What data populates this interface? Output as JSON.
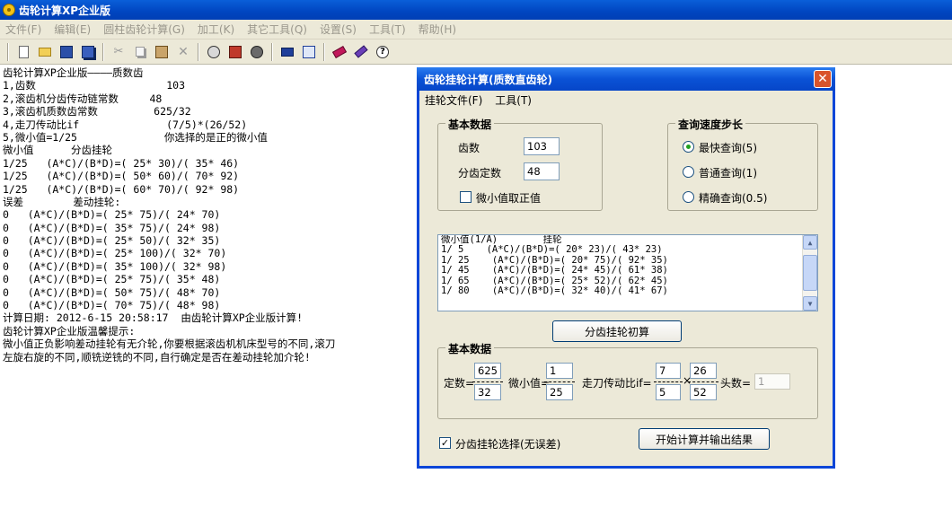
{
  "window": {
    "title": "齿轮计算XP企业版"
  },
  "menu": [
    "文件(F)",
    "编辑(E)",
    "圆柱齿轮计算(G)",
    "加工(K)",
    "其它工具(Q)",
    "设置(S)",
    "工具(T)",
    "帮助(H)"
  ],
  "toolbar_icons": [
    "new-icon",
    "open-icon",
    "save-icon",
    "save-all-icon",
    "cut-icon",
    "copy-icon",
    "paste-icon",
    "delete-icon",
    "print-preview-icon",
    "print-icon",
    "gear-settings-icon",
    "calculator-icon",
    "export-icon",
    "book-icon",
    "edit-icon",
    "help-icon"
  ],
  "log_lines": [
    "齿轮计算XP企业版————质数齿",
    "1,齿数                     103",
    "2,滚齿机分齿传动链常数     48",
    "3,滚齿机质数齿常数         625/32",
    "4,走刀传动比if              (7/5)*(26/52)",
    "5,微小值=1/25              你选择的是正的微小值",
    "微小值      分齿挂轮",
    "1/25   (A*C)/(B*D)=( 25* 30)/( 35* 46)",
    "1/25   (A*C)/(B*D)=( 50* 60)/( 70* 92)",
    "1/25   (A*C)/(B*D)=( 60* 70)/( 92* 98)",
    "误差        差动挂轮:",
    "0   (A*C)/(B*D)=( 25* 75)/( 24* 70)",
    "0   (A*C)/(B*D)=( 35* 75)/( 24* 98)",
    "0   (A*C)/(B*D)=( 25* 50)/( 32* 35)",
    "0   (A*C)/(B*D)=( 25* 100)/( 32* 70)",
    "0   (A*C)/(B*D)=( 35* 100)/( 32* 98)",
    "0   (A*C)/(B*D)=( 25* 75)/( 35* 48)",
    "0   (A*C)/(B*D)=( 50* 75)/( 48* 70)",
    "0   (A*C)/(B*D)=( 70* 75)/( 48* 98)",
    "计算日期: 2012-6-15 20:58:17  由齿轮计算XP企业版计算!",
    "齿轮计算XP企业版温馨提示:",
    "微小值正负影响差动挂轮有无介轮,你要根据滚齿机机床型号的不同,滚刀",
    "左旋右旋的不同,顺铣逆铣的不同,自行确定是否在差动挂轮加介轮!"
  ],
  "dialog": {
    "title": "齿轮挂轮计算(质数直齿轮)",
    "menu": [
      "挂轮文件(F)",
      "工具(T)"
    ],
    "basic": {
      "title": "基本数据",
      "teeth_label": "齿数",
      "teeth_value": "103",
      "index_label": "分齿定数",
      "index_value": "48",
      "positive_label": "微小值取正值",
      "positive_checked": false
    },
    "speed": {
      "title": "查询速度步长",
      "options": [
        "最快查询(5)",
        "普通查询(1)",
        "精确查询(0.5)"
      ],
      "selected": 0
    },
    "results": [
      "微小值(1/A)        挂轮",
      "1/ 5    (A*C)/(B*D)=( 20* 23)/( 43* 23)",
      "1/ 25    (A*C)/(B*D)=( 20* 75)/( 92* 35)",
      "1/ 45    (A*C)/(B*D)=( 24* 45)/( 61* 38)",
      "1/ 65    (A*C)/(B*D)=( 25* 52)/( 62* 45)",
      "1/ 80    (A*C)/(B*D)=( 32* 40)/( 41* 67)"
    ],
    "calc_index_button": "分齿挂轮初算",
    "basic2": {
      "title": "基本数据",
      "constant_label": "定数=",
      "constant_num": "625",
      "constant_den": "32",
      "small_label": "微小值=",
      "small_num": "1",
      "small_den": "25",
      "feed_label": "走刀传动比if=",
      "feed_num1": "7",
      "feed_den1": "5",
      "times": "×",
      "feed_num2": "26",
      "feed_den2": "52",
      "heads_label": "头数=",
      "heads_value": "1"
    },
    "index_select_label": "分齿挂轮选择(无误差)",
    "index_select_checked": true,
    "start_button": "开始计算并输出结果"
  }
}
